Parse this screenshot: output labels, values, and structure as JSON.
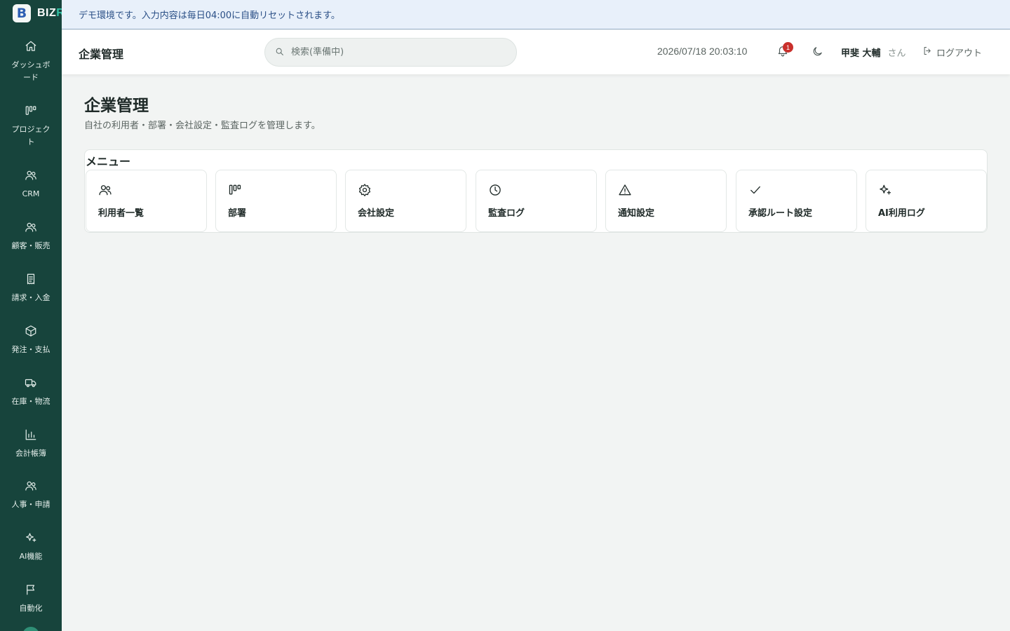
{
  "app": {
    "logo_letter": "B",
    "logo_text": "BIZ",
    "logo_text_accent": "R"
  },
  "banner": {
    "text": "デモ環境です。入力内容は毎日04:00に自動リセットされます。"
  },
  "header": {
    "title": "企業管理",
    "search_placeholder": "検索(準備中)",
    "datetime": "2026/07/18 20:03:10",
    "notification_count": "1",
    "user_name": "甲斐 大輔",
    "user_suffix": "さん",
    "logout_label": "ログアウト"
  },
  "sidebar": {
    "items": [
      {
        "label": "ダッシュボード",
        "icon": "home-icon"
      },
      {
        "label": "プロジェクト",
        "icon": "kanban-icon"
      },
      {
        "label": "CRM",
        "icon": "users-icon"
      },
      {
        "label": "顧客・販売",
        "icon": "users-icon"
      },
      {
        "label": "請求・入金",
        "icon": "receipt-icon"
      },
      {
        "label": "発注・支払",
        "icon": "package-icon"
      },
      {
        "label": "在庫・物流",
        "icon": "truck-icon"
      },
      {
        "label": "会計帳簿",
        "icon": "bar-chart-icon"
      },
      {
        "label": "人事・申請",
        "icon": "users-icon"
      },
      {
        "label": "AI機能",
        "icon": "sparkles-icon"
      },
      {
        "label": "自動化",
        "icon": "flag-icon"
      }
    ]
  },
  "main": {
    "title": "企業管理",
    "subtitle": "自社の利用者・部署・会社設定・監査ログを管理します。",
    "menu_heading": "メニュー",
    "cards": [
      {
        "label": "利用者一覧",
        "icon": "users-icon"
      },
      {
        "label": "部署",
        "icon": "kanban-icon"
      },
      {
        "label": "会社設定",
        "icon": "gear-icon"
      },
      {
        "label": "監査ログ",
        "icon": "clock-icon"
      },
      {
        "label": "通知設定",
        "icon": "warning-icon"
      },
      {
        "label": "承認ルート設定",
        "icon": "check-icon"
      },
      {
        "label": "AI利用ログ",
        "icon": "sparkles-icon"
      }
    ]
  },
  "colors": {
    "sidebar_bg": "#17443c",
    "accent": "#33c2a5",
    "banner_bg": "#e8f0fa",
    "badge": "#c9302c"
  }
}
